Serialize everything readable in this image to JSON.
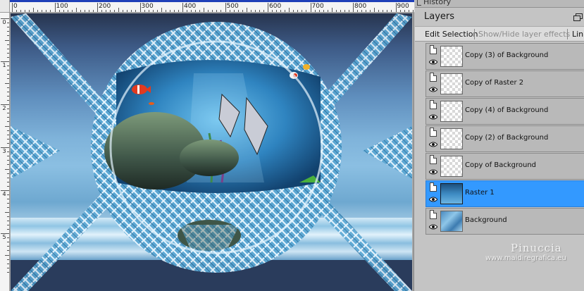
{
  "history_panel": {
    "title": "History"
  },
  "layers_panel": {
    "title": "Layers",
    "toolbar": {
      "edit_selection": "Edit Selection",
      "show_hide_effects": "Show/Hide layer effects",
      "link": "Link"
    },
    "layers": [
      {
        "name": "Copy (3) of Background",
        "thumb": "checker",
        "selected": false
      },
      {
        "name": "Copy of Raster 2",
        "thumb": "checker",
        "selected": false
      },
      {
        "name": "Copy (4) of Background",
        "thumb": "checker",
        "selected": false
      },
      {
        "name": "Copy (2) of Background",
        "thumb": "checker",
        "selected": false
      },
      {
        "name": "Copy of Background",
        "thumb": "checker",
        "selected": false
      },
      {
        "name": "Raster 1",
        "thumb": "raster1",
        "selected": true
      },
      {
        "name": "Background",
        "thumb": "bg",
        "selected": false
      }
    ]
  },
  "watermark": {
    "name": "Pinuccia",
    "url": "www.maidiregrafica.eu"
  },
  "ruler": {
    "top_labels": [
      "0",
      "100",
      "200",
      "300",
      "400",
      "500",
      "600",
      "700",
      "800",
      "900"
    ],
    "left_labels": [
      "0",
      "1",
      "2",
      "3",
      "4",
      "5"
    ]
  },
  "colors": {
    "selection_blue": "#3399ff",
    "panel_gray": "#c4c4c4",
    "ruler_blue": "#1f3fb8"
  }
}
